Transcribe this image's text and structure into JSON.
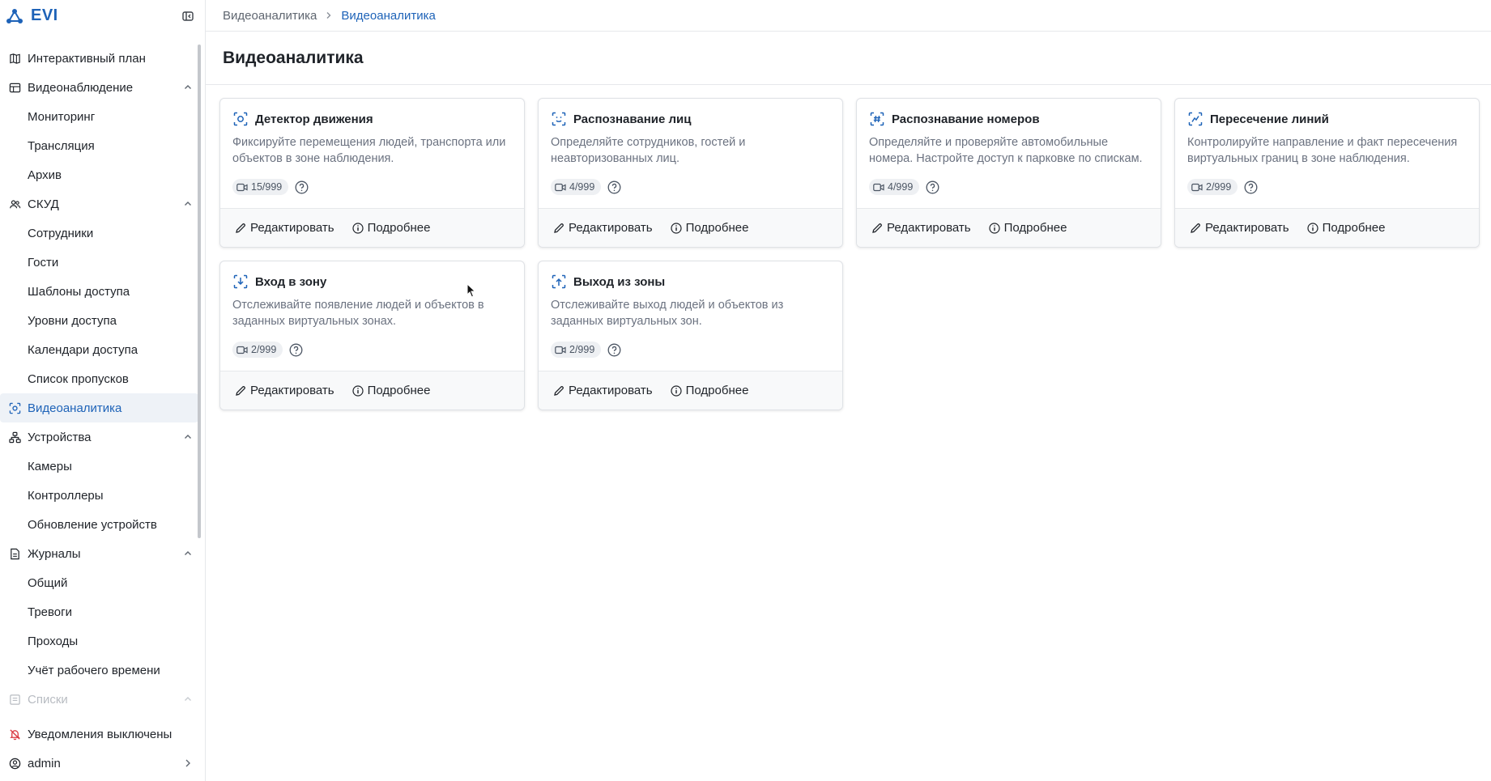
{
  "brand": {
    "name": "EVI"
  },
  "colors": {
    "accent": "#1e63b8",
    "alert": "#d9363e"
  },
  "sidebar": {
    "sections": [
      {
        "label": "Интерактивный план",
        "icon": "map-icon",
        "expandable": false,
        "items": []
      },
      {
        "label": "Видеонаблюдение",
        "icon": "cctv-icon",
        "expandable": true,
        "items": [
          "Мониторинг",
          "Трансляция",
          "Архив"
        ]
      },
      {
        "label": "СКУД",
        "icon": "users-icon",
        "expandable": true,
        "items": [
          "Сотрудники",
          "Гости",
          "Шаблоны доступа",
          "Уровни доступа",
          "Календари доступа",
          "Список пропусков"
        ]
      },
      {
        "label": "Видеоаналитика",
        "icon": "scan-icon",
        "expandable": false,
        "active": true,
        "items": []
      },
      {
        "label": "Устройства",
        "icon": "devices-icon",
        "expandable": true,
        "items": [
          "Камеры",
          "Контроллеры",
          "Обновление устройств"
        ]
      },
      {
        "label": "Журналы",
        "icon": "journal-icon",
        "expandable": true,
        "items": [
          "Общий",
          "Тревоги",
          "Проходы",
          "Учёт рабочего времени"
        ]
      },
      {
        "label": "Списки",
        "icon": "list-icon",
        "expandable": true,
        "faded": true,
        "items": []
      }
    ],
    "footer": {
      "notifications": "Уведомления выключены",
      "user": "admin"
    }
  },
  "breadcrumb": {
    "parent": "Видеоаналитика",
    "current": "Видеоаналитика"
  },
  "page": {
    "title": "Видеоаналитика"
  },
  "actions": {
    "edit": "Редактировать",
    "details": "Подробнее"
  },
  "cards": [
    {
      "title": "Детектор движения",
      "desc": "Фиксируйте перемещения людей, транспорта или объектов в зоне наблюдения.",
      "count": "15/999",
      "icon": "motion-detect-icon"
    },
    {
      "title": "Распознавание лиц",
      "desc": "Определяйте сотрудников, гостей и неавторизованных лиц.",
      "count": "4/999",
      "icon": "face-scan-icon"
    },
    {
      "title": "Распознавание номеров",
      "desc": "Определяйте и проверяйте автомобильные номера. Настройте доступ к парковке по спискам.",
      "count": "4/999",
      "icon": "plate-scan-icon"
    },
    {
      "title": "Пересечение линий",
      "desc": "Контролируйте направление и факт пересечения виртуальных границ в зоне наблюдения.",
      "count": "2/999",
      "icon": "line-cross-icon"
    },
    {
      "title": "Вход в зону",
      "desc": "Отслеживайте появление людей и объектов в заданных виртуальных зонах.",
      "count": "2/999",
      "icon": "zone-enter-icon"
    },
    {
      "title": "Выход из зоны",
      "desc": "Отслеживайте выход людей и объектов из заданных виртуальных зон.",
      "count": "2/999",
      "icon": "zone-exit-icon"
    }
  ]
}
